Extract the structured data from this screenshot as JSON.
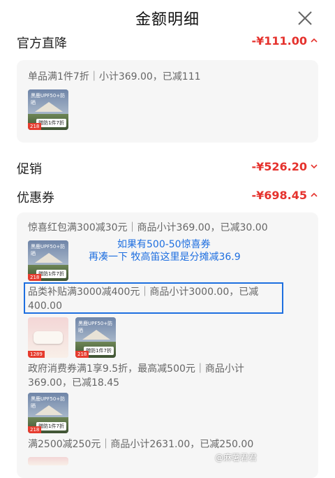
{
  "header": {
    "title": "金额明细",
    "close_icon": "close-icon"
  },
  "official_discount": {
    "label": "官方直降",
    "amount": "-¥111.00",
    "chevron": "chevron-up-icon",
    "rule": "单品满1件7折｜小计369.00，已减111"
  },
  "promotion": {
    "label": "促销",
    "amount": "-¥526.20",
    "chevron": "chevron-down-icon"
  },
  "coupon": {
    "label": "优惠券",
    "amount": "-¥698.45",
    "chevron": "chevron-up-icon",
    "items": [
      {
        "text": "惊喜红包满300减30元｜商品小计369.00，已减30.00"
      },
      {
        "text": "品类补贴满3000减400元｜商品小计3000.00，已减400.00"
      },
      {
        "text": "政府消费券满1享9.5折，最高减500元｜商品小计369.00，已减18.45"
      },
      {
        "text": "满2500减250元｜商品小计2631.00，已减250.00"
      }
    ]
  },
  "product_thumbs": {
    "tent_brand": "黑鹿UPF50+防晒",
    "tent_tag": "赠防1件7折",
    "tent_badge": "218",
    "pad_badge": "1289"
  },
  "annotation": {
    "line1": "如果有500-50惊喜券",
    "line2": "再凑一下 牧高笛这里是分摊减36.9"
  },
  "watermark": "@麻薯君君",
  "colors": {
    "accent_red": "#e5322d",
    "annotation_blue": "#1e6fe0",
    "card_bg": "#f6f6f6"
  }
}
